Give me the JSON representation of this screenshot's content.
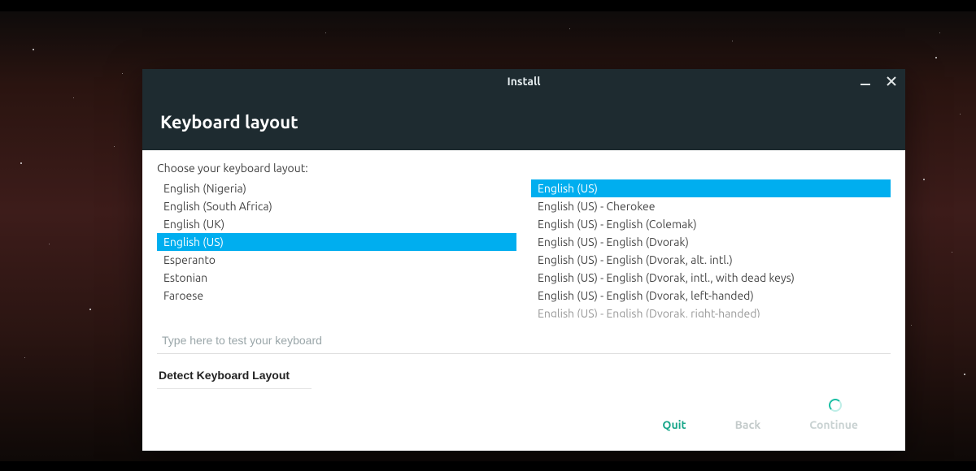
{
  "window": {
    "title": "Install",
    "heading": "Keyboard layout"
  },
  "prompt": "Choose your keyboard layout:",
  "layouts": {
    "selected_index": 3,
    "items": [
      "English (Nigeria)",
      "English (South Africa)",
      "English (UK)",
      "English (US)",
      "Esperanto",
      "Estonian",
      "Faroese"
    ]
  },
  "variants": {
    "selected_index": 0,
    "items": [
      "English (US)",
      "English (US) - Cherokee",
      "English (US) - English (Colemak)",
      "English (US) - English (Dvorak)",
      "English (US) - English (Dvorak, alt. intl.)",
      "English (US) - English (Dvorak, intl., with dead keys)",
      "English (US) - English (Dvorak, left-handed)",
      "English (US) - English (Dvorak, right-handed)"
    ]
  },
  "test_input": {
    "value": "",
    "placeholder": "Type here to test your keyboard"
  },
  "detect_button": "Detect Keyboard Layout",
  "footer": {
    "quit": "Quit",
    "back": "Back",
    "continue": "Continue"
  },
  "colors": {
    "selection": "#00aeef",
    "header": "#1e2b30",
    "accent": "#16a589"
  }
}
